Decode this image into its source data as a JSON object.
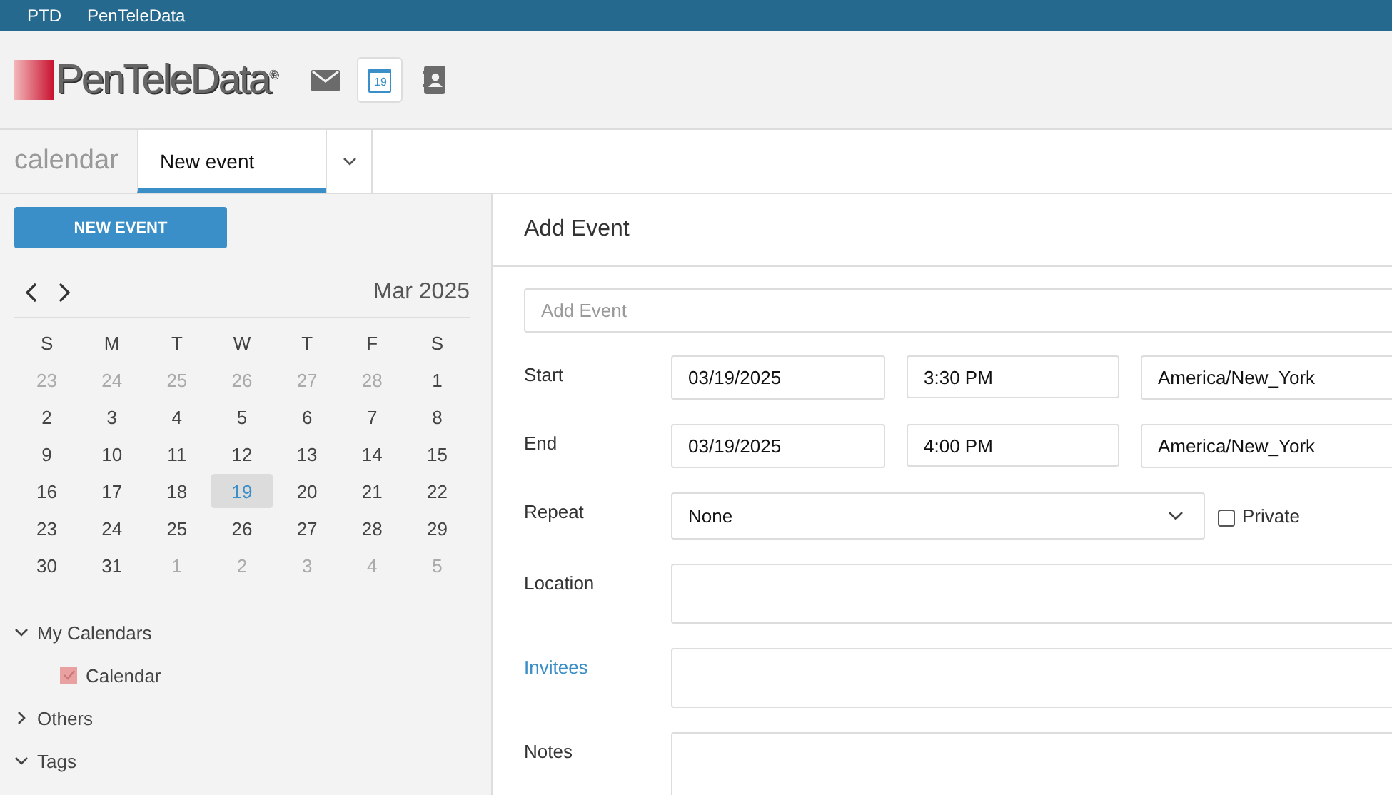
{
  "top_bar": {
    "items": [
      "PTD",
      "PenTeleData"
    ]
  },
  "header": {
    "logo_text": "PenTeleData",
    "logo_mark": "®",
    "apps": [
      {
        "kind": "mail",
        "selected": false
      },
      {
        "kind": "calendar",
        "label": "19",
        "selected": true
      },
      {
        "kind": "contacts",
        "selected": false
      }
    ]
  },
  "tab_bar": {
    "app_title": "calendar",
    "tabs": [
      {
        "label": "New event",
        "selected": true
      }
    ]
  },
  "sidebar": {
    "new_button": "NEW EVENT",
    "month": "Mar 2025",
    "weekdays": [
      "S",
      "M",
      "T",
      "W",
      "T",
      "F",
      "S"
    ],
    "weeks": [
      [
        {
          "label": "23",
          "muted": true,
          "selected": false
        },
        {
          "label": "24",
          "muted": true,
          "selected": false
        },
        {
          "label": "25",
          "muted": true,
          "selected": false
        },
        {
          "label": "26",
          "muted": true,
          "selected": false
        },
        {
          "label": "27",
          "muted": true,
          "selected": false
        },
        {
          "label": "28",
          "muted": true,
          "selected": false
        },
        {
          "label": "1",
          "muted": false,
          "selected": false
        }
      ],
      [
        {
          "label": "2",
          "muted": false,
          "selected": false
        },
        {
          "label": "3",
          "muted": false,
          "selected": false
        },
        {
          "label": "4",
          "muted": false,
          "selected": false
        },
        {
          "label": "5",
          "muted": false,
          "selected": false
        },
        {
          "label": "6",
          "muted": false,
          "selected": false
        },
        {
          "label": "7",
          "muted": false,
          "selected": false
        },
        {
          "label": "8",
          "muted": false,
          "selected": false
        }
      ],
      [
        {
          "label": "9",
          "muted": false,
          "selected": false
        },
        {
          "label": "10",
          "muted": false,
          "selected": false
        },
        {
          "label": "11",
          "muted": false,
          "selected": false
        },
        {
          "label": "12",
          "muted": false,
          "selected": false
        },
        {
          "label": "13",
          "muted": false,
          "selected": false
        },
        {
          "label": "14",
          "muted": false,
          "selected": false
        },
        {
          "label": "15",
          "muted": false,
          "selected": false
        }
      ],
      [
        {
          "label": "16",
          "muted": false,
          "selected": false
        },
        {
          "label": "17",
          "muted": false,
          "selected": false
        },
        {
          "label": "18",
          "muted": false,
          "selected": false
        },
        {
          "label": "19",
          "muted": false,
          "selected": true
        },
        {
          "label": "20",
          "muted": false,
          "selected": false
        },
        {
          "label": "21",
          "muted": false,
          "selected": false
        },
        {
          "label": "22",
          "muted": false,
          "selected": false
        }
      ],
      [
        {
          "label": "23",
          "muted": false,
          "selected": false
        },
        {
          "label": "24",
          "muted": false,
          "selected": false
        },
        {
          "label": "25",
          "muted": false,
          "selected": false
        },
        {
          "label": "26",
          "muted": false,
          "selected": false
        },
        {
          "label": "27",
          "muted": false,
          "selected": false
        },
        {
          "label": "28",
          "muted": false,
          "selected": false
        },
        {
          "label": "29",
          "muted": false,
          "selected": false
        }
      ],
      [
        {
          "label": "30",
          "muted": false,
          "selected": false
        },
        {
          "label": "31",
          "muted": false,
          "selected": false
        },
        {
          "label": "1",
          "muted": true,
          "selected": false
        },
        {
          "label": "2",
          "muted": true,
          "selected": false
        },
        {
          "label": "3",
          "muted": true,
          "selected": false
        },
        {
          "label": "4",
          "muted": true,
          "selected": false
        },
        {
          "label": "5",
          "muted": true,
          "selected": false
        }
      ]
    ],
    "tree": [
      {
        "label": "My Calendars",
        "expanded": true,
        "children": [
          {
            "label": "Calendar",
            "checked": true,
            "color": "#e8a0a0"
          }
        ]
      },
      {
        "label": "Others",
        "expanded": false
      },
      {
        "label": "Tags",
        "expanded": true
      }
    ]
  },
  "form": {
    "title": "Add Event",
    "subject": {
      "placeholder": "Add Event"
    },
    "rows": [
      {
        "kind": "datetime",
        "label": "Start",
        "date": "03/19/2025",
        "time": "3:30 PM",
        "timezone": "America/New_York"
      },
      {
        "kind": "datetime",
        "label": "End",
        "date": "03/19/2025",
        "time": "4:00 PM",
        "timezone": "America/New_York"
      },
      {
        "kind": "select",
        "label": "Repeat",
        "value": "None",
        "checkbox": {
          "label": "Private",
          "checked": false
        }
      },
      {
        "kind": "text",
        "label": "Location"
      },
      {
        "kind": "link",
        "label": "Invitees"
      },
      {
        "kind": "text",
        "label": "Notes"
      }
    ]
  }
}
